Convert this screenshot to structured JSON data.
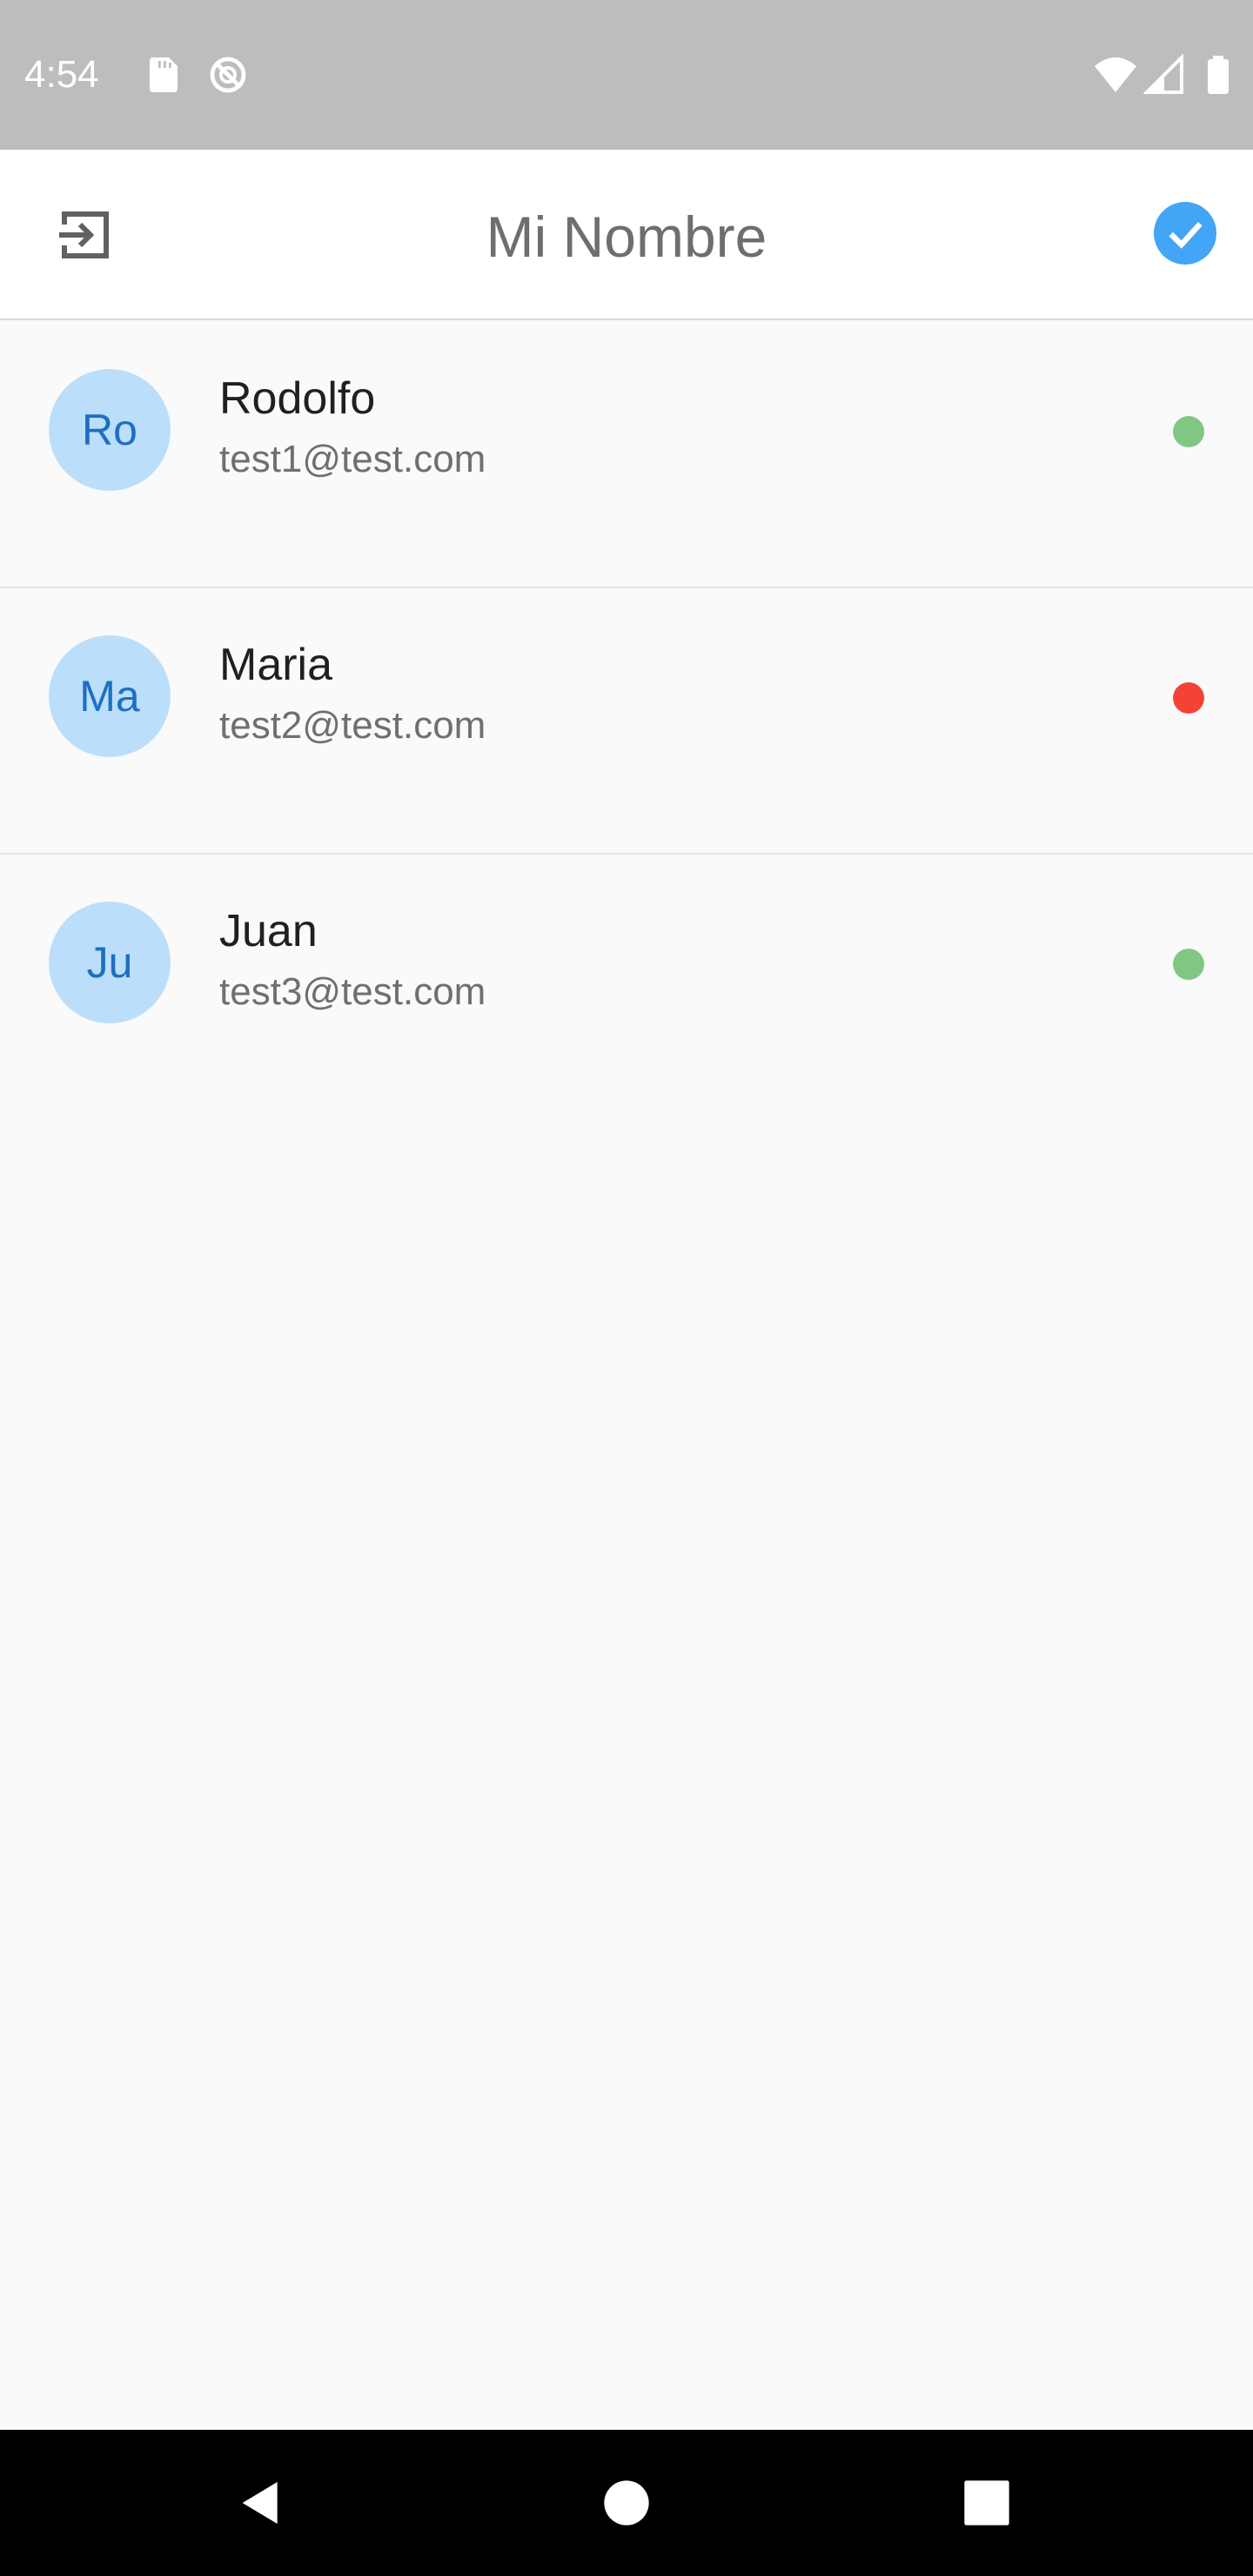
{
  "status_bar": {
    "time": "4:54",
    "icons": [
      "sd-card-icon",
      "do-not-disturb-icon",
      "wifi-icon",
      "signal-icon",
      "battery-icon"
    ]
  },
  "app_bar": {
    "title": "Mi Nombre",
    "left_icon": "logout-icon",
    "right_icon": "check-circle-icon",
    "accent_color": "#42a5f5"
  },
  "users": [
    {
      "initials": "Ro",
      "name": "Rodolfo",
      "email": "test1@test.com",
      "online": true,
      "status_color": "#81c784"
    },
    {
      "initials": "Ma",
      "name": "Maria",
      "email": "test2@test.com",
      "online": false,
      "status_color": "#f44336"
    },
    {
      "initials": "Ju",
      "name": "Juan",
      "email": "test3@test.com",
      "online": true,
      "status_color": "#81c784"
    }
  ],
  "nav_bar": {
    "icons": [
      "back-icon",
      "home-icon",
      "recents-icon"
    ]
  }
}
